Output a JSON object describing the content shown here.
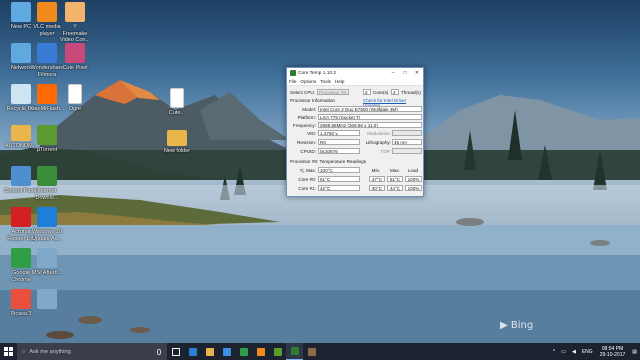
{
  "desktop": {
    "icons": [
      {
        "label": "New PC",
        "icon": "computer-icon",
        "color": "#5fa8e0"
      },
      {
        "label": "VLC media player",
        "icon": "vlc-icon",
        "color": "#f08a1c"
      },
      {
        "label": "Y",
        "sublabel": "Freemake Video Con...",
        "icon": "freemake-icon",
        "color": "#f4b36a"
      },
      {
        "label": "Network",
        "icon": "network-icon",
        "color": "#5fa8e0"
      },
      {
        "label": "Wondershare Filmora",
        "icon": "filmora-icon",
        "color": "#3a7bd5"
      },
      {
        "label": "Cute Pixel",
        "icon": "pixel-icon",
        "color": "#c94a7a"
      },
      {
        "label": "Recycle Bin",
        "icon": "recycle-bin-icon",
        "color": "#cfe4f2"
      },
      {
        "label": "XiaoMiFlash...",
        "icon": "xiaomi-icon",
        "color": "#ff6a00"
      },
      {
        "label": "Ogre",
        "icon": "file-icon",
        "color": "#ffffff"
      },
      {
        "label": "Cute...",
        "icon": "file-icon",
        "color": "#ffffff"
      },
      {
        "label": "AUTONOM...",
        "icon": "folder-icon",
        "color": "#e8b64a"
      },
      {
        "label": "µTorrent",
        "icon": "utorrent-icon",
        "color": "#5a9a2f"
      },
      {
        "label": "New folder",
        "icon": "folder-icon",
        "color": "#e8b64a"
      },
      {
        "label": "Control Panel",
        "icon": "control-panel-icon",
        "color": "#4f8fd0"
      },
      {
        "label": "Internet Downlo...",
        "icon": "idm-icon",
        "color": "#3b8d3b"
      },
      {
        "label": "Acrobat Reader DC",
        "icon": "acrobat-icon",
        "color": "#d21f1f"
      },
      {
        "label": "Windows 10 Update As...",
        "icon": "windows-update-icon",
        "color": "#1e7fd8"
      },
      {
        "label": "Google Chrome",
        "icon": "chrome-icon",
        "color": "#2f9e44"
      },
      {
        "label": "MSI Afterb...",
        "icon": "image-icon",
        "color": "#7fa8c9"
      },
      {
        "label": "Picasa 3",
        "icon": "picasa-icon",
        "color": "#e94f3b"
      },
      {
        "label": "",
        "icon": "image-icon",
        "color": "#7fa8c9"
      }
    ]
  },
  "coretemp": {
    "title": "Core Temp 1.10.2",
    "menu": [
      "File",
      "Options",
      "Tools",
      "Help"
    ],
    "select_cpu_label": "Select CPU:",
    "select_cpu_value": "Processor #0",
    "cores_count": "2",
    "cores_label": "Core(s)",
    "threads_count": "2",
    "threads_label": "Thread(s)",
    "proc_info_label": "Processor Information",
    "driver_link": "Check for Intel Driver Updates",
    "model_label": "Model:",
    "model_value": "Intel Core 2 Duo E7500 (Wolfdale 3M)",
    "platform_label": "Platform:",
    "platform_value": "LGA 775 (Socket T)",
    "frequency_label": "Frequency:",
    "frequency_value": "2969.58MHz (269.96 x 11.0)",
    "vid_label": "VID:",
    "vid_value": "1.2750 v",
    "modulation_label": "Modulation:",
    "revision_label": "Revision:",
    "revision_value": "R0",
    "lithography_label": "Lithography:",
    "lithography_value": "45 nm",
    "cpuid_label": "CPUID:",
    "cpuid_value": "0x10676",
    "tdp_label": "TDP:",
    "temps_label": "Processor #0: Temperature Readings",
    "col_min": "Min.",
    "col_max": "Max.",
    "col_load": "Load",
    "tjmax_label": "Tj. Max:",
    "tjmax_value": "100°C",
    "cores": [
      {
        "label": "Core #0:",
        "temp": "51°C",
        "min": "47°C",
        "max": "51°C",
        "load": "100%"
      },
      {
        "label": "Core #1:",
        "temp": "42°C",
        "min": "40°C",
        "max": "44°C",
        "load": "100%"
      }
    ]
  },
  "taskbar": {
    "search_placeholder": "Ask me anything",
    "apps": [
      {
        "icon": "task-view-icon",
        "color": "#ffffff"
      },
      {
        "icon": "edge-icon",
        "color": "#2b7fd6"
      },
      {
        "icon": "file-explorer-icon",
        "color": "#e8b64a"
      },
      {
        "icon": "store-icon",
        "color": "#3a8ee6"
      },
      {
        "icon": "chrome-icon",
        "color": "#2f9e44"
      },
      {
        "icon": "vlc-icon",
        "color": "#f08a1c"
      },
      {
        "icon": "utorrent-icon",
        "color": "#5a9a2f"
      },
      {
        "icon": "coretemp-icon",
        "color": "#2f7d32"
      },
      {
        "icon": "photos-icon",
        "color": "#8a6a4a"
      }
    ],
    "language": "ENG",
    "time": "08:54 PM",
    "date": "29-10-2017"
  },
  "watermark": "Bing"
}
